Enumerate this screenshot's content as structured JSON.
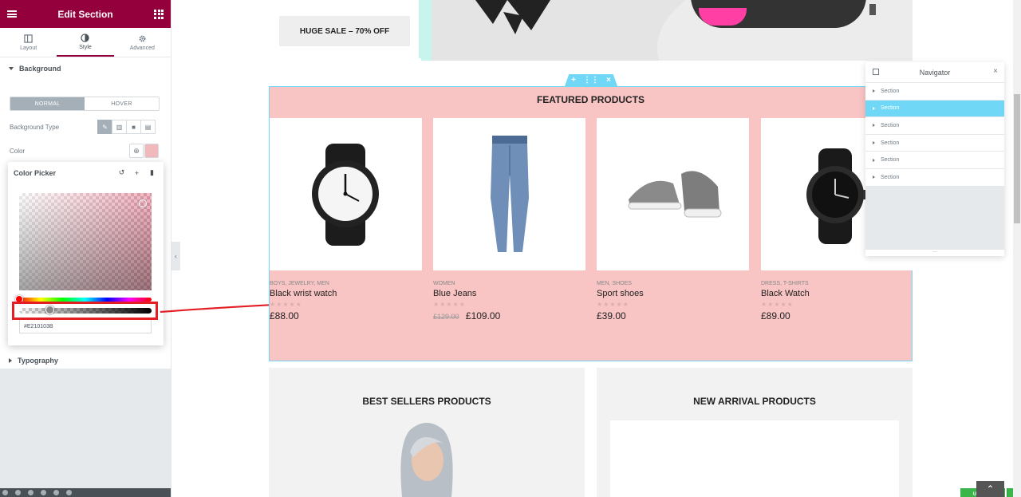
{
  "panel": {
    "title": "Edit Section",
    "tabs": [
      {
        "label": "Layout",
        "icon": "layout-icon"
      },
      {
        "label": "Style",
        "icon": "style-icon",
        "active": true
      },
      {
        "label": "Advanced",
        "icon": "gear-icon"
      }
    ],
    "background_heading": "Background",
    "state_tabs": {
      "normal": "NORMAL",
      "hover": "HOVER",
      "selected": "NORMAL"
    },
    "background_type_label": "Background Type",
    "color_label": "Color",
    "typography_heading": "Typography",
    "update_label": "UPDATE",
    "accent_color": "#93003C"
  },
  "color_picker": {
    "title": "Color Picker",
    "hex_value": "#E210103B",
    "swatch_color": "#F2B9BD",
    "alpha_percent": 23
  },
  "page": {
    "hero_button": "HUGE SALE – 70% OFF",
    "featured_title": "FEATURED PRODUCTS",
    "featured_bg": "#F8C4C4",
    "products": [
      {
        "categories": "BOYS, JEWELRY, MEN",
        "name": "Black wrist watch",
        "old_price": "",
        "price": "£88.00"
      },
      {
        "categories": "WOMEN",
        "name": "Blue Jeans",
        "old_price": "£129.00",
        "price": "£109.00"
      },
      {
        "categories": "MEN, SHOES",
        "name": "Sport shoes",
        "old_price": "",
        "price": "£39.00"
      },
      {
        "categories": "DRESS, T-SHIRTS",
        "name": "Black Watch",
        "old_price": "",
        "price": "£89.00"
      }
    ],
    "best_sellers_title": "BEST SELLERS PRODUCTS",
    "new_arrival_title": "NEW ARRIVAL PRODUCTS"
  },
  "navigator": {
    "title": "Navigator",
    "items": [
      "Section",
      "Section",
      "Section",
      "Section",
      "Section",
      "Section"
    ],
    "selected_index": 1
  }
}
